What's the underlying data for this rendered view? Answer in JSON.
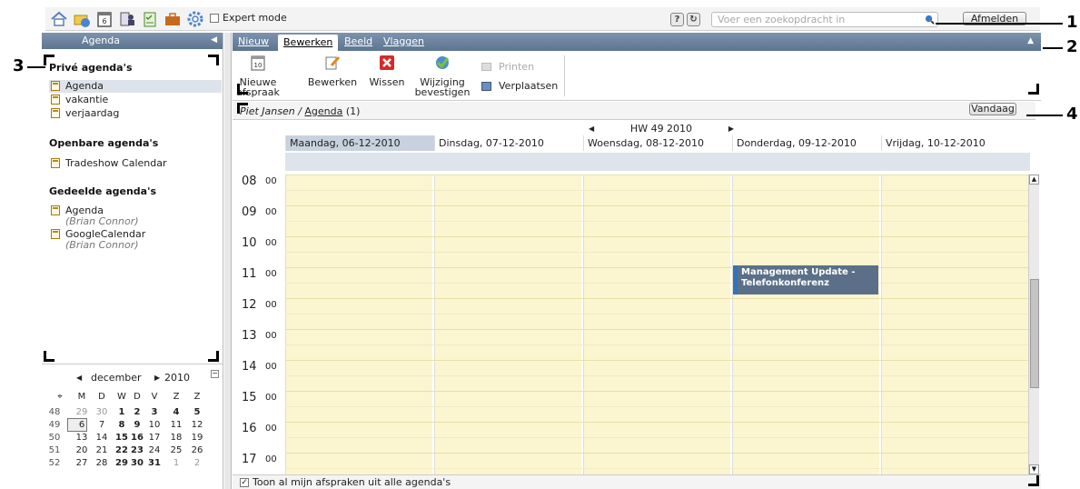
{
  "toolbar": {
    "expert_mode": "Expert mode",
    "help": "?",
    "refresh": "↻",
    "search_placeholder": "Voer een zoekopdracht in",
    "logout": "Afmelden"
  },
  "left": {
    "header": "Agenda",
    "private_title": "Privé agenda's",
    "private_items": [
      "Agenda",
      "vakantie",
      "verjaardag"
    ],
    "public_title": "Openbare agenda's",
    "public_items": [
      "Tradeshow Calendar"
    ],
    "shared_title": "Gedeelde agenda's",
    "shared_items": [
      {
        "name": "Agenda",
        "owner": "(Brian Connor)"
      },
      {
        "name": "GoogleCalendar",
        "owner": "(Brian Connor)"
      }
    ]
  },
  "minical": {
    "month": "december",
    "year": "2010",
    "weekdays": [
      "M",
      "D",
      "W",
      "D",
      "V",
      "Z",
      "Z"
    ],
    "rows": [
      {
        "wk": "48",
        "days": [
          "29",
          "30",
          "1",
          "2",
          "3",
          "4",
          "5"
        ]
      },
      {
        "wk": "49",
        "days": [
          "6",
          "7",
          "8",
          "9",
          "10",
          "11",
          "12"
        ]
      },
      {
        "wk": "50",
        "days": [
          "13",
          "14",
          "15",
          "16",
          "17",
          "18",
          "19"
        ]
      },
      {
        "wk": "51",
        "days": [
          "20",
          "21",
          "22",
          "23",
          "24",
          "25",
          "26"
        ]
      },
      {
        "wk": "52",
        "days": [
          "27",
          "28",
          "29",
          "30",
          "31",
          "1",
          "2"
        ]
      }
    ]
  },
  "tabs": [
    "Nieuw",
    "Bewerken",
    "Beeld",
    "Vlaggen"
  ],
  "ribbon": {
    "new_appt": "Nieuwe afspraak",
    "edit": "Bewerken",
    "delete": "Wissen",
    "confirm": "Wijziging bevestigen",
    "print": "Printen",
    "move": "Verplaatsen"
  },
  "path": {
    "user": "Piet Jansen",
    "sep": " / ",
    "folder": "Agenda",
    "count": " (1)",
    "today": "Vandaag"
  },
  "week": {
    "label": "HW 49 2010",
    "days": [
      "Maandag, 06-12-2010",
      "Dinsdag, 07-12-2010",
      "Woensdag, 08-12-2010",
      "Donderdag, 09-12-2010",
      "Vrijdag, 10-12-2010"
    ],
    "hours": [
      "08",
      "09",
      "10",
      "11",
      "12",
      "13",
      "14",
      "15",
      "16",
      "17"
    ],
    "minutes": "00"
  },
  "event": {
    "title": "Management Update - Telefonkonferenz"
  },
  "footer": {
    "show_all": "Toon al mijn afspraken uit alle agenda's"
  },
  "callouts": [
    "1",
    "2",
    "3",
    "4"
  ],
  "colors": {
    "header_blue": "#5d7590",
    "event_bg": "#5b7088",
    "event_bar": "#3373b4",
    "grid_yellow": "#fbf6cf",
    "selected_day": "#c8d2de"
  }
}
